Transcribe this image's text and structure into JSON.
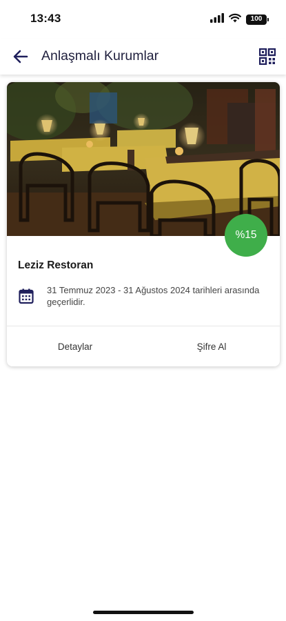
{
  "status_bar": {
    "time": "13:43",
    "battery": "100"
  },
  "app_bar": {
    "title": "Anlaşmalı Kurumlar",
    "back_icon": "back-arrow-icon",
    "qr_icon": "qr-code-icon"
  },
  "card": {
    "discount": "%15",
    "title": "Leziz Restoran",
    "validity": "31 Temmuz 2023 - 31 Ağustos 2024 tarihleri arasında geçerlidir.",
    "actions": {
      "details": "Detaylar",
      "get_password": "Şifre Al"
    }
  },
  "colors": {
    "primary": "#1f1f5c",
    "badge": "#3fae4a"
  }
}
